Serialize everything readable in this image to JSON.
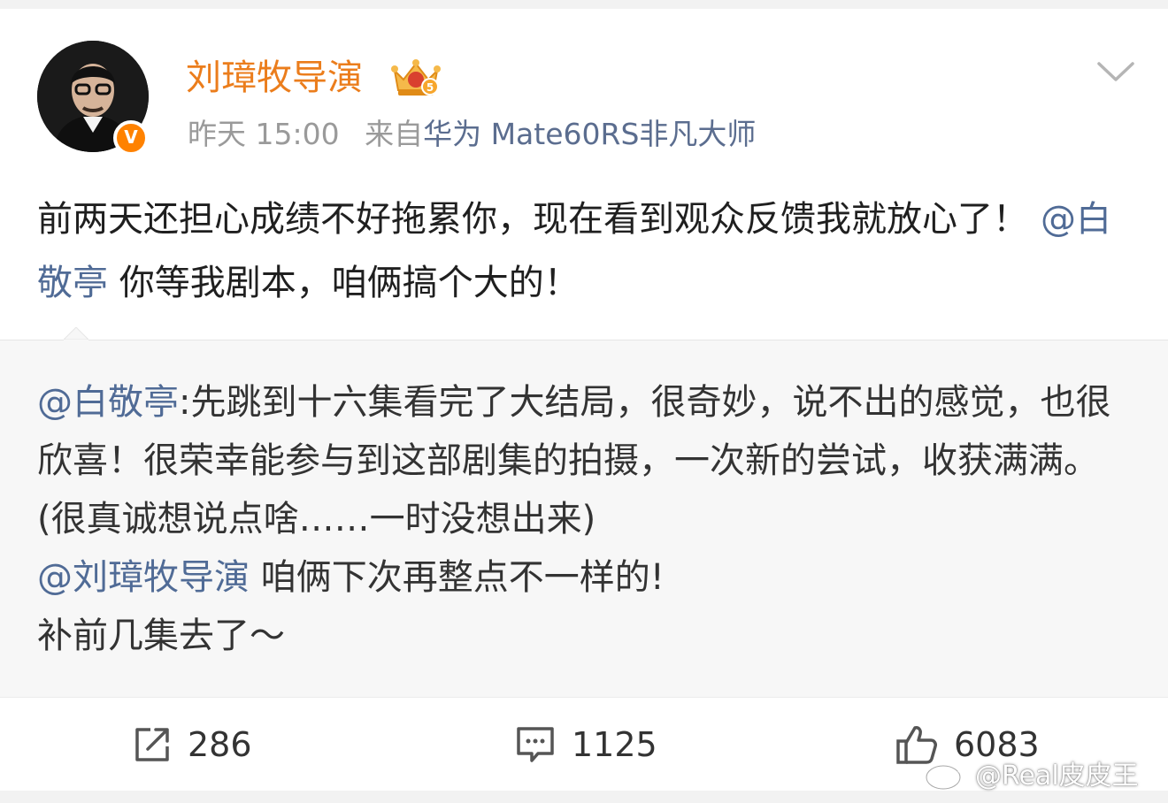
{
  "post": {
    "author": "刘璋牧导演",
    "verified_badge": "V",
    "time": "昨天 15:00",
    "source_prefix": "来自",
    "source_device": "华为 Mate60RS非凡大师",
    "text_part1": "前两天还担心成绩不好拖累你，现在看到观众反馈我就放心了！",
    "mention": "@白敬亭",
    "text_part2": " 你等我剧本，咱俩搞个大的！",
    "icons": {
      "vip": "crown-vip-icon",
      "menu": "chevron-down-icon"
    }
  },
  "repost": {
    "mention1": "@白敬亭",
    "text1": ":先跳到十六集看完了大结局，很奇妙，说不出的感觉，也很欣喜！很荣幸能参与到这部剧集的拍摄，一次新的尝试，收获满满。(很真诚想说点啥……一时没想出来)",
    "mention2": "@刘璋牧导演",
    "text2": " 咱俩下次再整点不一样的!",
    "text3": "补前几集去了～"
  },
  "actions": {
    "repost": {
      "icon": "share-icon",
      "count": "286"
    },
    "comment": {
      "icon": "comment-icon",
      "count": "1125"
    },
    "like": {
      "icon": "thumbs-up-icon",
      "count": "6083"
    }
  },
  "watermark": {
    "icon": "weibo-logo-icon",
    "text": "@Real皮皮王"
  },
  "colors": {
    "name": "#eb7d1c",
    "mention": "#506b96",
    "meta": "#9a9a9a",
    "badge": "#ff8200",
    "repost_bg": "#f7f7f7"
  }
}
